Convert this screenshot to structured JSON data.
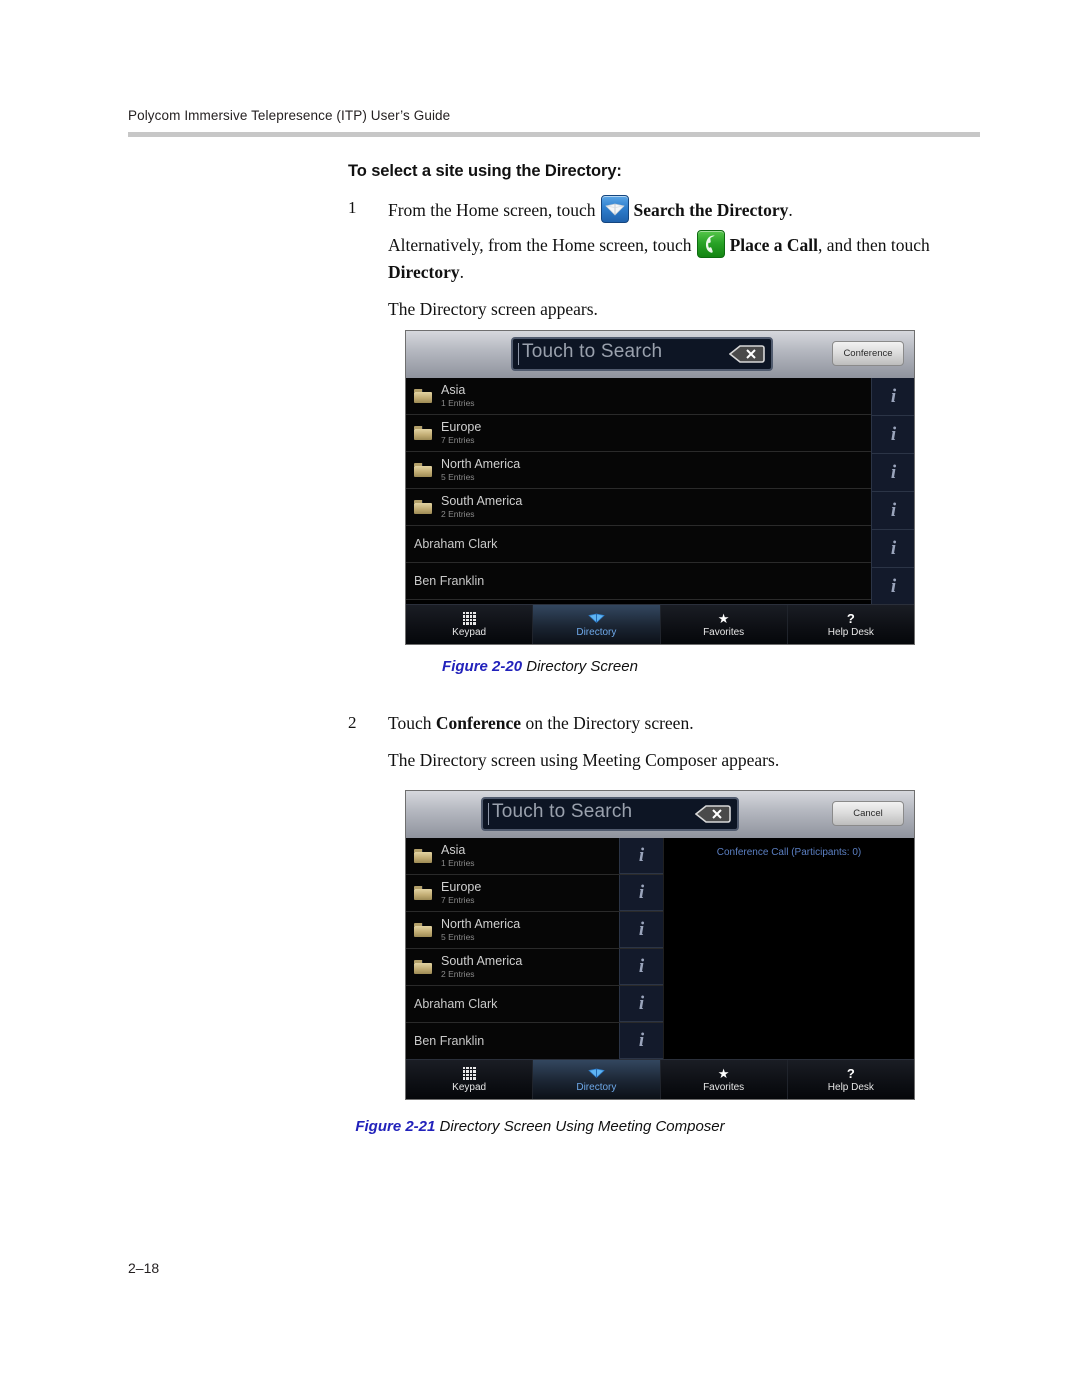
{
  "header": {
    "title": "Polycom Immersive Telepresence (ITP) User’s Guide"
  },
  "page_number": "2–18",
  "procedure": {
    "title": "To select a site using the Directory:",
    "steps": [
      {
        "num": "1",
        "line1_a": "From the Home screen, touch",
        "line1_icon": "directory-book-icon",
        "line1_b": "Search the Directory",
        "line1_c": ".",
        "line2_a": "Alternatively, from the Home screen, touch",
        "line2_icon": "green-phone-icon",
        "line2_b": "Place a Call",
        "line2_c": ", and then touch",
        "line2_d": "Directory",
        "line2_e": ".",
        "line3": "The Directory screen appears."
      },
      {
        "num": "2",
        "line1_a": "Touch",
        "line1_b": "Conference",
        "line1_c": "on the Directory screen.",
        "line2": "The Directory screen using Meeting Composer appears."
      }
    ]
  },
  "figures": [
    {
      "caption_number": "Figure 2-20",
      "caption_text": "Directory Screen",
      "search_placeholder": "Touch to Search",
      "top_button": "Conference",
      "backspace_icon": "backspace-icon",
      "entries": [
        {
          "type": "folder",
          "name": "Asia",
          "sub": "1 Entries",
          "info": "i"
        },
        {
          "type": "folder",
          "name": "Europe",
          "sub": "7 Entries",
          "info": "i"
        },
        {
          "type": "folder",
          "name": "North America",
          "sub": "5 Entries",
          "info": "i"
        },
        {
          "type": "folder",
          "name": "South America",
          "sub": "2 Entries",
          "info": "i"
        },
        {
          "type": "person",
          "name": "Abraham Clark",
          "sub": "",
          "info": "i"
        },
        {
          "type": "person",
          "name": "Ben Franklin",
          "sub": "",
          "info": "i"
        }
      ],
      "tabs": [
        {
          "label": "Keypad",
          "icon": "keypad-grid-icon",
          "selected": false
        },
        {
          "label": "Directory",
          "icon": "directory-book-icon",
          "selected": true
        },
        {
          "label": "Favorites",
          "icon": "star-icon",
          "selected": false
        },
        {
          "label": "Help Desk",
          "icon": "question-mark-icon",
          "selected": false
        }
      ]
    },
    {
      "caption_number": "Figure 2-21",
      "caption_text": "Directory Screen Using Meeting Composer",
      "search_placeholder": "Touch to Search",
      "top_button": "Cancel",
      "backspace_icon": "backspace-icon",
      "conference_panel_label": "Conference Call (Participants: 0)",
      "entries": [
        {
          "type": "folder",
          "name": "Asia",
          "sub": "1 Entries",
          "info": "i"
        },
        {
          "type": "folder",
          "name": "Europe",
          "sub": "7 Entries",
          "info": "i"
        },
        {
          "type": "folder",
          "name": "North America",
          "sub": "5 Entries",
          "info": "i"
        },
        {
          "type": "folder",
          "name": "South America",
          "sub": "2 Entries",
          "info": "i"
        },
        {
          "type": "person",
          "name": "Abraham Clark",
          "sub": "",
          "info": "i"
        },
        {
          "type": "person",
          "name": "Ben Franklin",
          "sub": "",
          "info": "i"
        }
      ],
      "tabs": [
        {
          "label": "Keypad",
          "icon": "keypad-grid-icon",
          "selected": false
        },
        {
          "label": "Directory",
          "icon": "directory-book-icon",
          "selected": true
        },
        {
          "label": "Favorites",
          "icon": "star-icon",
          "selected": false
        },
        {
          "label": "Help Desk",
          "icon": "question-mark-icon",
          "selected": false
        }
      ]
    }
  ],
  "colors": {
    "caption_number": "#2222bb",
    "selected_tab_text": "#6ea8e8",
    "conference_label": "#5b7fc2",
    "header_rule": "#c7c7c7"
  }
}
